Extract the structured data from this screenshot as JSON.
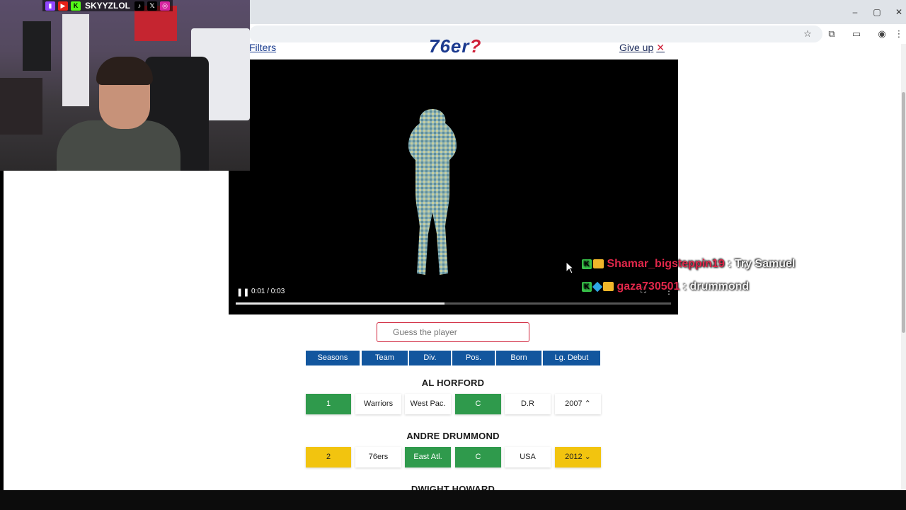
{
  "browser": {
    "window_controls": [
      "–",
      "▢",
      "✕"
    ],
    "toolbar_icons": [
      "star-icon",
      "extensions-icon",
      "cast-icon",
      "profile-icon",
      "menu-icon"
    ]
  },
  "site": {
    "filters_label": "Filters",
    "logo_text": "76er",
    "logo_accent": "?",
    "giveup_label": "Give up",
    "giveup_icon": "✕"
  },
  "video": {
    "time": "0:01 / 0:03",
    "progress": 0.48
  },
  "chat": [
    {
      "user": "Shamar_bigsteppin19",
      "message": ": Try Samuel"
    },
    {
      "user": "gaza730501",
      "message": ": drummond"
    }
  ],
  "guess": {
    "placeholder": "Guess the player"
  },
  "filters": [
    "Seasons",
    "Team",
    "Div.",
    "Pos.",
    "Born",
    "Lg. Debut"
  ],
  "guesses": [
    {
      "name": "AL HORFORD",
      "cells": [
        {
          "value": "1",
          "status": "green"
        },
        {
          "value": "Warriors",
          "status": "none"
        },
        {
          "value": "West Pac.",
          "status": "none"
        },
        {
          "value": "C",
          "status": "green"
        },
        {
          "value": "D.R",
          "status": "none"
        },
        {
          "value": "2007 ⌃",
          "status": "none"
        }
      ]
    },
    {
      "name": "ANDRE DRUMMOND",
      "cells": [
        {
          "value": "2",
          "status": "yellow"
        },
        {
          "value": "76ers",
          "status": "none"
        },
        {
          "value": "East Atl.",
          "status": "green"
        },
        {
          "value": "C",
          "status": "green"
        },
        {
          "value": "USA",
          "status": "none"
        },
        {
          "value": "2012 ⌄",
          "status": "yellow"
        }
      ]
    },
    {
      "name": "DWIGHT HOWARD",
      "cells": []
    }
  ],
  "webcam": {
    "handle": "SKYYZLOL",
    "socials": [
      "twitch-icon",
      "youtube-icon",
      "kick-icon",
      "tiktok-icon",
      "x-icon",
      "instagram-icon"
    ]
  },
  "colors": {
    "green": "#2f9a4c",
    "yellow": "#f2c40f",
    "filter_blue": "#12569e",
    "accent_red": "#d0223a"
  }
}
